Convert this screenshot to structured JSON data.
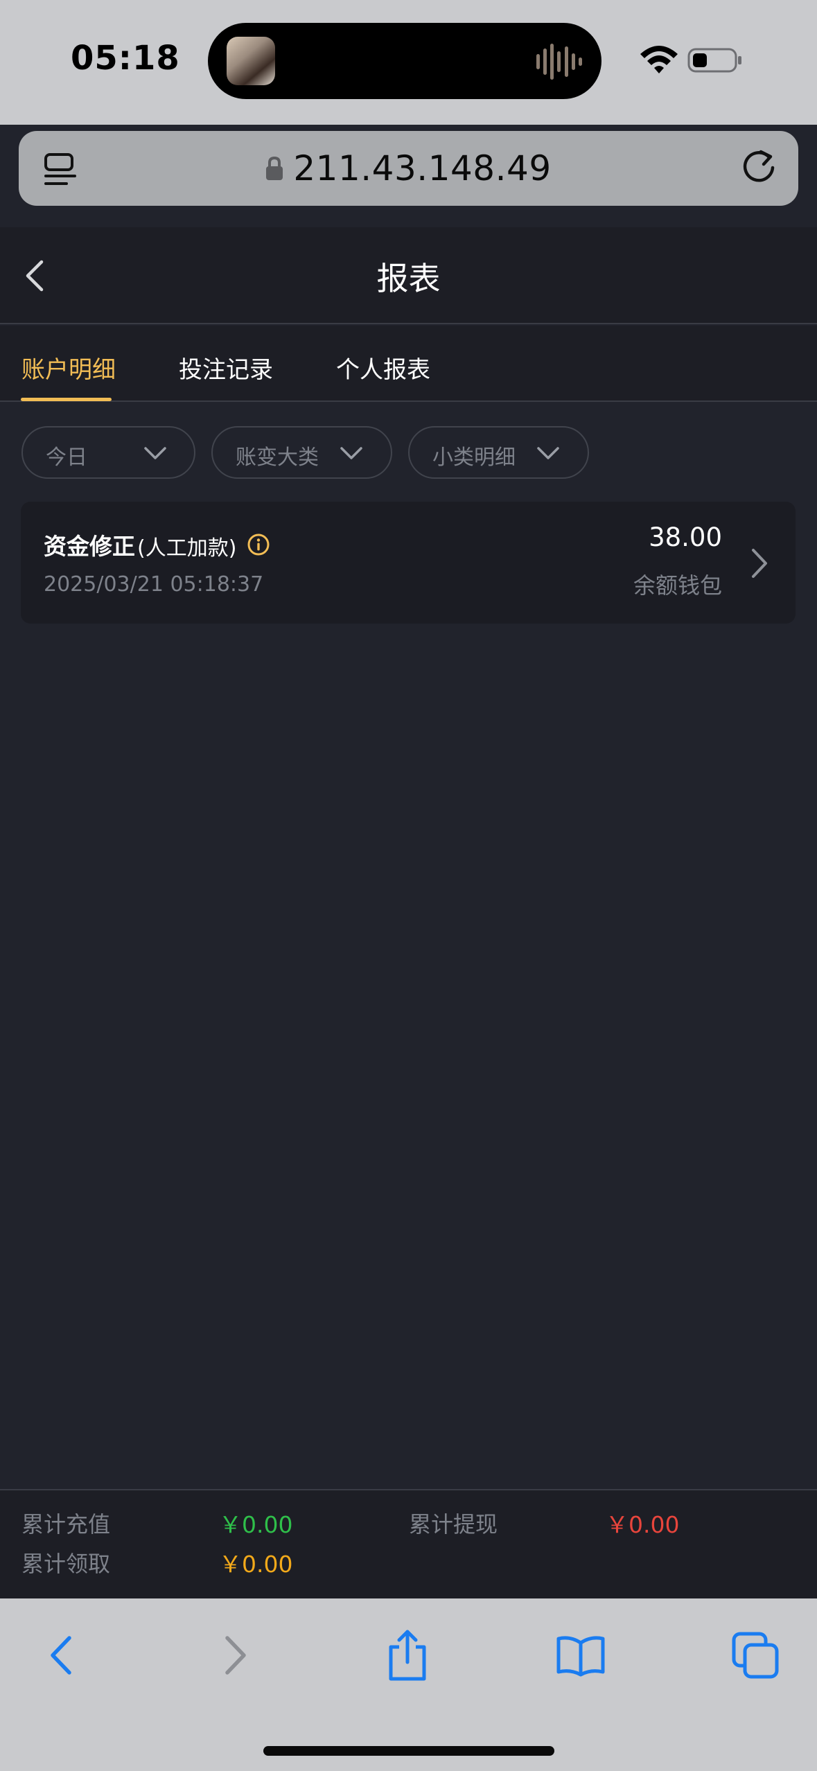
{
  "status_bar": {
    "time": "05:18",
    "island_activity": "audio-waveform",
    "wifi_icon": "wifi-icon",
    "battery_icon": "battery-low-icon"
  },
  "browser": {
    "url": "211.43.148.49",
    "reader_icon": "reader-mode-icon",
    "reload_icon": "reload-icon",
    "lock_icon": "lock-icon"
  },
  "header": {
    "title": "报表",
    "back_icon": "chevron-left-icon"
  },
  "tabs": [
    {
      "label": "账户明细",
      "active": true
    },
    {
      "label": "投注记录",
      "active": false
    },
    {
      "label": "个人报表",
      "active": false
    }
  ],
  "filters": [
    {
      "label": "今日"
    },
    {
      "label": "账变大类"
    },
    {
      "label": "小类明细"
    }
  ],
  "records": [
    {
      "title": "资金修正",
      "subtitle": "(人工加款)",
      "time": "2025/03/21 05:18:37",
      "amount": "38.00",
      "wallet": "余额钱包"
    }
  ],
  "summary": {
    "recharge_label": "累计充值",
    "recharge_value": "￥0.00",
    "withdraw_label": "累计提现",
    "withdraw_value": "￥0.00",
    "claim_label": "累计领取",
    "claim_value": "￥0.00"
  },
  "colors": {
    "accent": "#f2bd55",
    "recharge": "#2fbf4a",
    "withdraw": "#e8453c",
    "claim": "#f2a91a",
    "ios_blue": "#1a7cf0"
  },
  "toolbar_icons": [
    "back-icon",
    "forward-icon",
    "share-icon",
    "bookmarks-icon",
    "tabs-icon"
  ]
}
